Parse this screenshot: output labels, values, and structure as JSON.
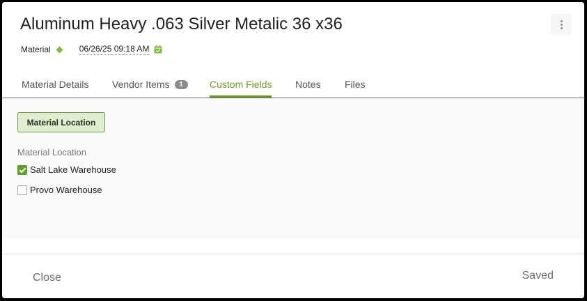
{
  "dialog": {
    "title": "Aluminum Heavy .063 Silver Metalic 36 x36",
    "type_label": "Material",
    "date": "06/26/25 09:18 AM"
  },
  "tabs": [
    {
      "label": "Material Details"
    },
    {
      "label": "Vendor Items",
      "badge": "1"
    },
    {
      "label": "Custom Fields",
      "active": true
    },
    {
      "label": "Notes"
    },
    {
      "label": "Files"
    }
  ],
  "custom_fields": {
    "section_button": "Material Location",
    "field_label": "Material Location",
    "options": [
      {
        "label": "Salt Lake Warehouse",
        "checked": true
      },
      {
        "label": "Provo Warehouse",
        "checked": false
      }
    ]
  },
  "footer": {
    "close_label": "Close",
    "status": "Saved"
  },
  "colors": {
    "accent": "#6a9b1f",
    "check": "#5f9e28",
    "section_button_bg": "#e1edd0"
  },
  "icons": {
    "type": "diamond-icon",
    "date": "calendar-check-icon",
    "menu": "more-vertical-icon"
  }
}
